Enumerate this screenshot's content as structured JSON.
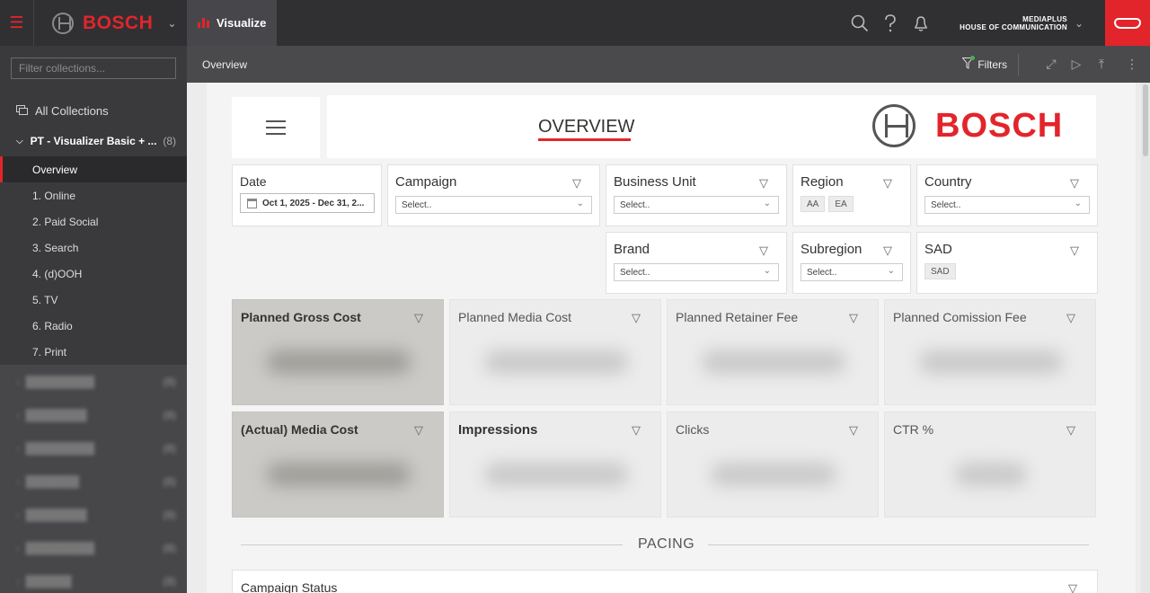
{
  "topbar": {
    "brand": "BOSCH",
    "visualize_tab": "Visualize",
    "agency_line1": "MEDIAPLUS",
    "agency_line2": "HOUSE OF COMMUNICATION"
  },
  "sidebar": {
    "filter_placeholder": "Filter collections...",
    "all_collections": "All Collections",
    "group": {
      "label": "PT - Visualizer Basic + ...",
      "count": "(8)"
    },
    "items": [
      "Overview",
      "1. Online",
      "2. Paid Social",
      "3. Search",
      "4. (d)OOH",
      "5. TV",
      "6. Radio",
      "7. Print"
    ],
    "blurred_counts": [
      "(8)",
      "(8)",
      "(8)",
      "(8)",
      "(8)",
      "(8)",
      "(8)"
    ]
  },
  "subbar": {
    "breadcrumb": "Overview",
    "filters_label": "Filters"
  },
  "dashboard": {
    "title": "OVERVIEW",
    "logo_text": "BOSCH",
    "date": {
      "label": "Date",
      "value": "Oct 1, 2025 - Dec 31, 2..."
    },
    "filters": {
      "campaign": {
        "label": "Campaign",
        "value": "Select.."
      },
      "business_unit": {
        "label": "Business Unit",
        "value": "Select.."
      },
      "region": {
        "label": "Region",
        "chips": [
          "AA",
          "EA"
        ]
      },
      "country": {
        "label": "Country",
        "value": "Select.."
      },
      "brand": {
        "label": "Brand",
        "value": "Select.."
      },
      "subregion": {
        "label": "Subregion",
        "value": "Select.."
      },
      "sad": {
        "label": "SAD",
        "chips": [
          "SAD"
        ]
      }
    },
    "kpis": [
      "Planned Gross Cost",
      "Planned Media Cost",
      "Planned Retainer Fee",
      "Planned Comission Fee",
      "(Actual) Media Cost",
      "Impressions",
      "Clicks",
      "CTR %"
    ],
    "pacing": "PACING",
    "campaign_status": "Campaign Status"
  }
}
